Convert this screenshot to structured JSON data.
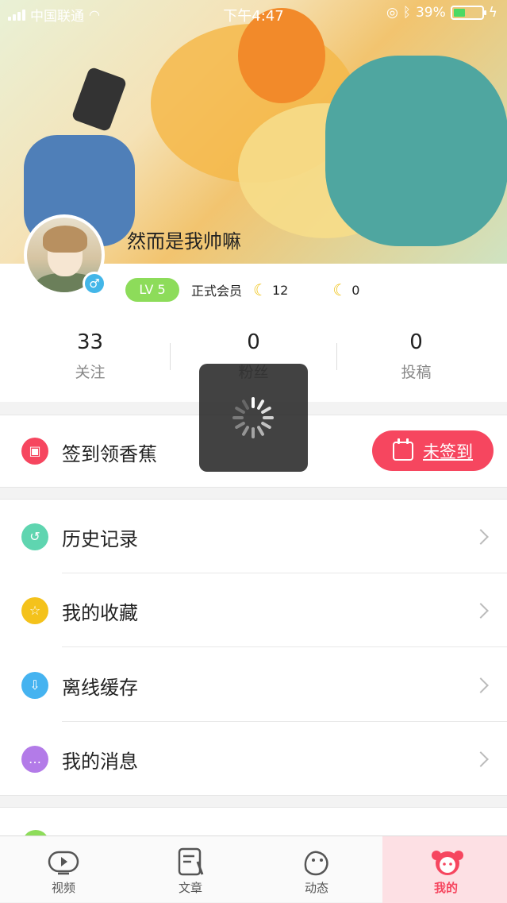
{
  "status_bar": {
    "carrier": "中国联通",
    "time": "下午4:47",
    "battery": "39%"
  },
  "profile": {
    "username": "然而是我帅嘛",
    "level": "LV 5",
    "membership": "正式会员",
    "banana_count_1": "12",
    "banana_count_2": "0"
  },
  "stats": [
    {
      "value": "33",
      "label": "关注"
    },
    {
      "value": "0",
      "label": "粉丝"
    },
    {
      "value": "0",
      "label": "投稿"
    }
  ],
  "checkin": {
    "label": "签到领香蕉",
    "button_label": "未签到"
  },
  "menu": [
    {
      "label": "历史记录",
      "icon": "history-icon",
      "color": "#5fd5b0"
    },
    {
      "label": "我的收藏",
      "icon": "star-icon",
      "color": "#f4c21b"
    },
    {
      "label": "离线缓存",
      "icon": "download-icon",
      "color": "#45b3f0"
    },
    {
      "label": "我的消息",
      "icon": "message-icon",
      "color": "#b37be8"
    }
  ],
  "tabs": [
    {
      "label": "视频",
      "icon": "video-icon"
    },
    {
      "label": "文章",
      "icon": "article-icon"
    },
    {
      "label": "动态",
      "icon": "feed-icon"
    },
    {
      "label": "我的",
      "icon": "me-icon"
    }
  ],
  "colors": {
    "accent": "#f6465f",
    "level_badge": "#8ddc5a",
    "gender_badge": "#43b6e8"
  }
}
